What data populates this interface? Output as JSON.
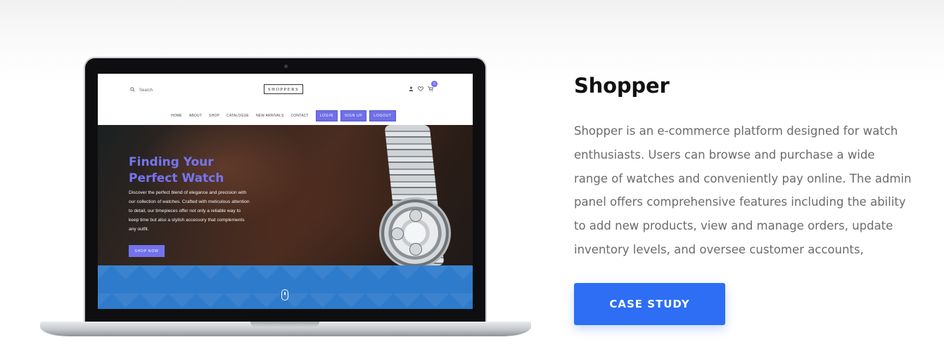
{
  "mockup": {
    "search_placeholder": "Search",
    "logo": "SHOPPERS",
    "cart_count": "0",
    "nav_links": [
      "HOME",
      "ABOUT",
      "SHOP",
      "CATALOGUE",
      "NEW ARRIVALS",
      "CONTACT"
    ],
    "nav_buttons": [
      "LOGIN",
      "SIGN UP",
      "LOGOUT"
    ],
    "hero_title_line1": "Finding Your",
    "hero_title_line2": "Perfect Watch",
    "hero_text": "Discover the perfect blend of elegance and precision with our collection of watches. Crafted with meticulous attention to detail, our timepieces offer not only a reliable way to keep time but also a stylish accessory that complements any outfit.",
    "hero_button": "SHOP NOW"
  },
  "project": {
    "title": "Shopper",
    "description": "Shopper is an e-commerce platform designed for watch enthusiasts. Users can browse and purchase a wide range of watches and conveniently pay online. The admin panel offers comprehensive features including the ability to add new products, view and manage orders, update inventory levels, and oversee customer accounts,",
    "button": "CASE STUDY"
  },
  "colors": {
    "accent": "#2e6ef5",
    "mockup_accent": "#7272ee",
    "band_blue": "#2f7bcb"
  },
  "icons": [
    "search-icon",
    "user-icon",
    "heart-icon",
    "cart-icon",
    "mouse-scroll-icon"
  ]
}
